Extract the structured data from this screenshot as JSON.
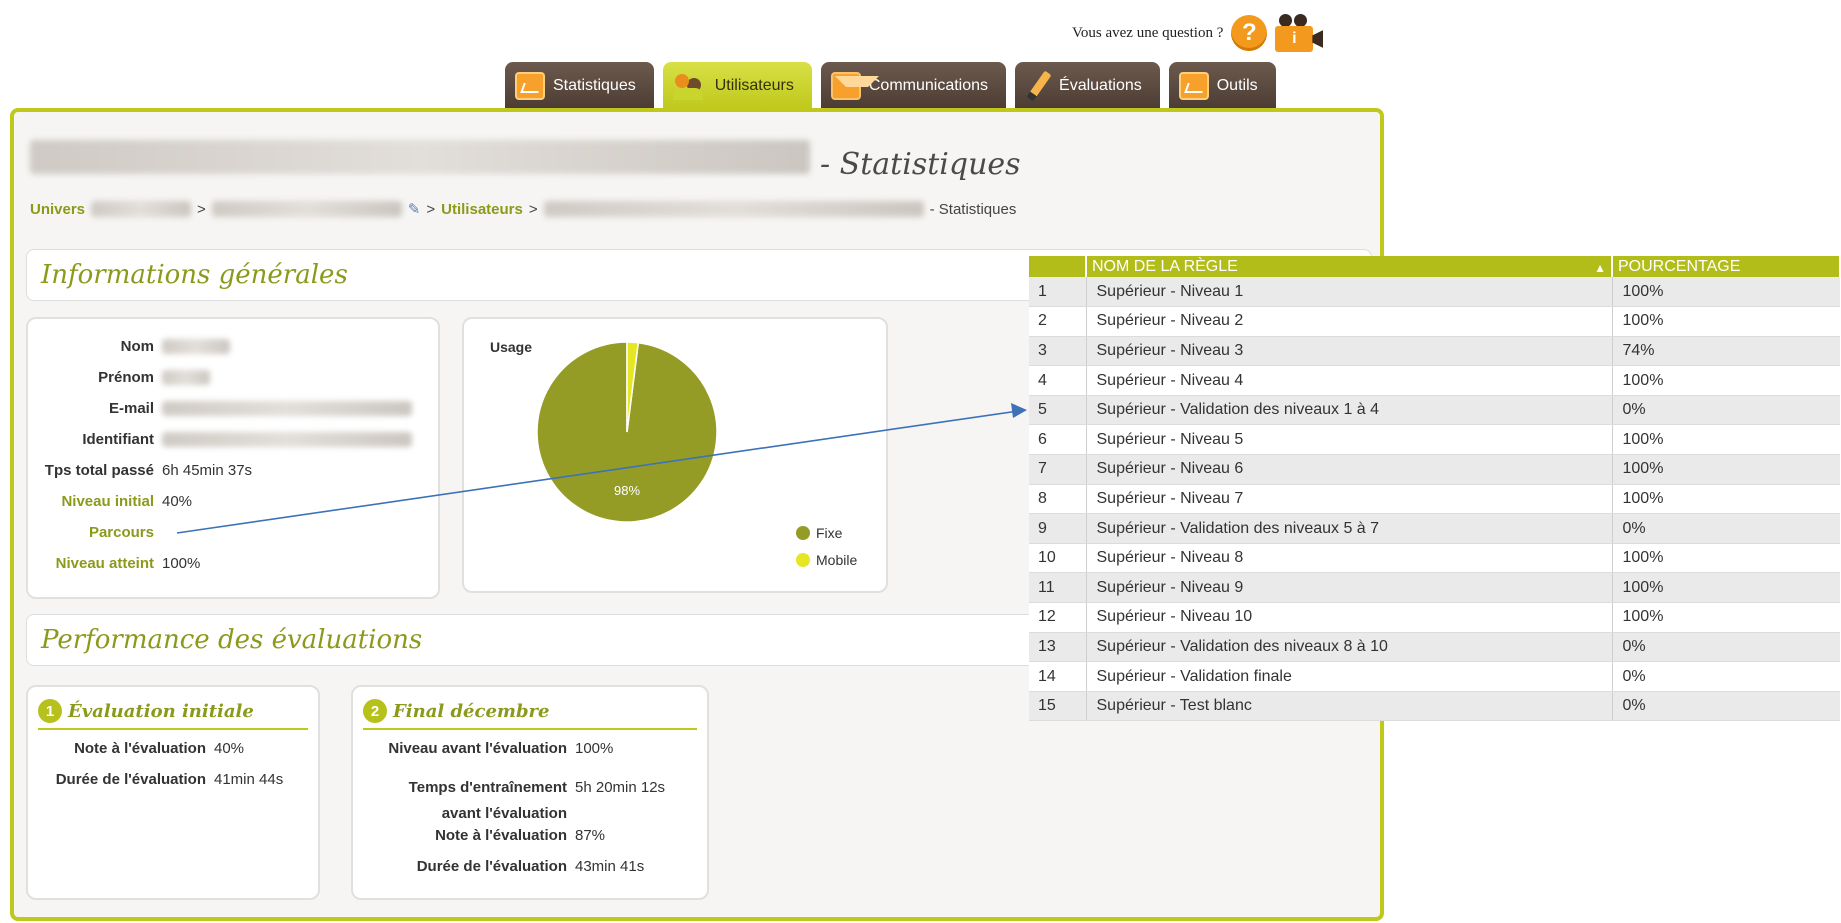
{
  "help": {
    "text": "Vous avez une question ?",
    "question_icon": "?",
    "info_icon": "i"
  },
  "tabs": [
    {
      "label": "Statistiques",
      "icon": "chart-icon",
      "active": false
    },
    {
      "label": "Utilisateurs",
      "icon": "users-icon",
      "active": true
    },
    {
      "label": "Communications",
      "icon": "mail-icon",
      "active": false
    },
    {
      "label": "Évaluations",
      "icon": "pencil-icon",
      "active": false
    },
    {
      "label": "Outils",
      "icon": "chart-icon",
      "active": false
    }
  ],
  "page": {
    "title_suffix": "- Statistiques",
    "breadcrumb": {
      "univers": "Univers",
      "sep": ">",
      "utilisateurs": "Utilisateurs",
      "last": "- Statistiques"
    }
  },
  "general": {
    "section_title": "Informations générales",
    "fields": [
      {
        "label": "Nom",
        "value": ""
      },
      {
        "label": "Prénom",
        "value": ""
      },
      {
        "label": "E-mail",
        "value": ""
      },
      {
        "label": "Identifiant",
        "value": ""
      },
      {
        "label": "Tps total passé",
        "value": "6h 45min 37s"
      },
      {
        "label": "Niveau initial",
        "value": "40%"
      },
      {
        "label": "Parcours",
        "value": ""
      },
      {
        "label": "Niveau atteint",
        "value": "100%"
      }
    ],
    "usage": {
      "title": "Usage",
      "slice_label": "98%",
      "legend": [
        {
          "label": "Fixe",
          "color": "#949c25"
        },
        {
          "label": "Mobile",
          "color": "#e5e722"
        }
      ]
    }
  },
  "chart_data": {
    "type": "pie",
    "title": "Usage",
    "categories": [
      "Fixe",
      "Mobile"
    ],
    "values": [
      98,
      2
    ],
    "colors": [
      "#949c25",
      "#e5e722"
    ],
    "legend": "right"
  },
  "performance": {
    "section_title": "Performance des évaluations",
    "evals": [
      {
        "num": "1",
        "title": "Évaluation initiale",
        "rows": [
          {
            "label": "Note à l'évaluation",
            "value": "40%"
          },
          {
            "label": "Durée de l'évaluation",
            "value": "41min 44s"
          }
        ]
      },
      {
        "num": "2",
        "title": "Final décembre",
        "rows": [
          {
            "label": "Niveau avant l'évaluation",
            "value": "100%"
          },
          {
            "label": "Temps d'entraînement avant l'évaluation",
            "value": "5h 20min 12s"
          },
          {
            "label": "Note à l'évaluation",
            "value": "87%"
          },
          {
            "label": "Durée de l'évaluation",
            "value": "43min 41s"
          }
        ]
      }
    ]
  },
  "rules_table": {
    "headers": [
      "",
      "NOM DE LA RÈGLE",
      "POURCENTAGE"
    ],
    "sort_indicator": "▲",
    "rows": [
      [
        "1",
        "Supérieur - Niveau 1",
        "100%"
      ],
      [
        "2",
        "Supérieur - Niveau 2",
        "100%"
      ],
      [
        "3",
        "Supérieur - Niveau 3",
        "74%"
      ],
      [
        "4",
        "Supérieur - Niveau 4",
        "100%"
      ],
      [
        "5",
        "Supérieur - Validation des niveaux 1 à 4",
        "0%"
      ],
      [
        "6",
        "Supérieur - Niveau 5",
        "100%"
      ],
      [
        "7",
        "Supérieur - Niveau 6",
        "100%"
      ],
      [
        "8",
        "Supérieur - Niveau 7",
        "100%"
      ],
      [
        "9",
        "Supérieur - Validation des niveaux 5 à 7",
        "0%"
      ],
      [
        "10",
        "Supérieur - Niveau 8",
        "100%"
      ],
      [
        "11",
        "Supérieur - Niveau 9",
        "100%"
      ],
      [
        "12",
        "Supérieur - Niveau 10",
        "100%"
      ],
      [
        "13",
        "Supérieur - Validation des niveaux 8 à 10",
        "0%"
      ],
      [
        "14",
        "Supérieur - Validation finale",
        "0%"
      ],
      [
        "15",
        "Supérieur - Test blanc",
        "0%"
      ]
    ]
  }
}
